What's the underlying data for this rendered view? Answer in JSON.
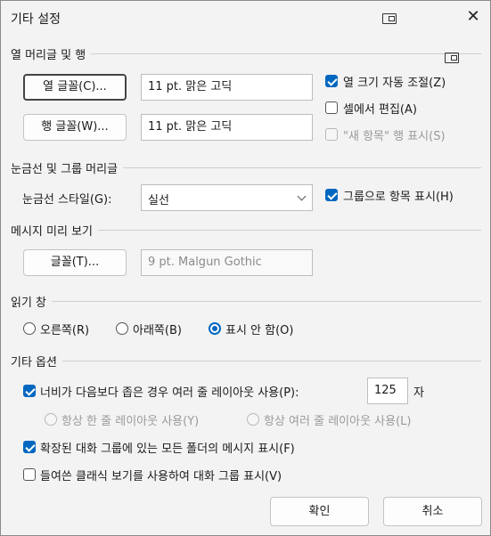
{
  "dialog": {
    "title": "기타 설정",
    "close_glyph": "✕",
    "ok_label": "확인",
    "cancel_label": "취소"
  },
  "columns_rows": {
    "heading": "열 머리글 및 행",
    "column_font_button": "열 글꼴(C)...",
    "column_font_value": "11 pt. 맑은 고딕",
    "row_font_button": "행 글꼴(W)...",
    "row_font_value": "11 pt. 맑은 고딕",
    "autosize_label": "열 크기 자동 조절(Z)",
    "autosize_checked": true,
    "incell_edit_label": "셀에서 편집(A)",
    "incell_edit_checked": false,
    "new_item_row_label": "\"새 항목\" 행 표시(S)",
    "new_item_row_checked": false,
    "new_item_row_disabled": true
  },
  "gridlines": {
    "heading": "눈금선 및 그룹 머리글",
    "style_label": "눈금선 스타일(G):",
    "style_value": "실선",
    "group_label": "그룹으로 항목 표시(H)",
    "group_checked": true
  },
  "preview": {
    "heading": "메시지 미리 보기",
    "font_button": "글꼴(T)...",
    "font_value": "9 pt. Malgun Gothic"
  },
  "reading_pane": {
    "heading": "읽기 창",
    "options": [
      {
        "label": "오른쪽(R)",
        "checked": false
      },
      {
        "label": "아래쪽(B)",
        "checked": false
      },
      {
        "label": "표시 안 함(O)",
        "checked": true
      }
    ]
  },
  "other": {
    "heading": "기타 옵션",
    "compact_label": "너비가 다음보다 좁은 경우 여러 줄 레이아웃 사용(P):",
    "compact_checked": true,
    "compact_value": "125",
    "compact_unit": "자",
    "always_single": "항상 한 줄 레이아웃 사용(Y)",
    "always_multi": "항상 여러 줄 레이아웃 사용(L)",
    "expanded_label": "확장된 대화 그룹에 있는 모든 폴더의 메시지 표시(F)",
    "expanded_checked": true,
    "classic_label": "들여쓴 클래식 보기를 사용하여 대화 그룹 표시(V)",
    "classic_checked": false
  },
  "icons": [
    "dialog-expand-icon",
    "section-expand-icon",
    "close-icon",
    "chevron-down-icon"
  ]
}
